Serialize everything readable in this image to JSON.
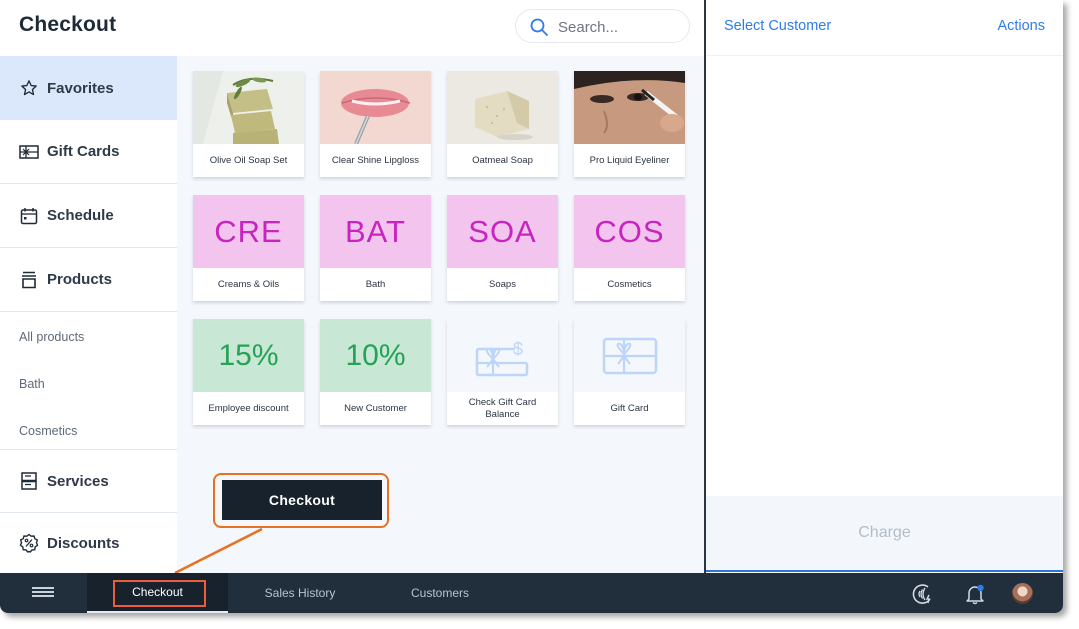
{
  "header": {
    "title": "Checkout",
    "search_placeholder": "Search..."
  },
  "sidebar": {
    "items": [
      {
        "label": "Favorites",
        "icon": "star-icon",
        "active": true
      },
      {
        "label": "Gift Cards",
        "icon": "gift-card-icon"
      },
      {
        "label": "Schedule",
        "icon": "calendar-icon"
      },
      {
        "label": "Products",
        "icon": "box-icon"
      },
      {
        "label": "Services",
        "icon": "services-icon"
      },
      {
        "label": "Discounts",
        "icon": "discount-badge-icon"
      }
    ],
    "product_subitems": [
      "All products",
      "Bath",
      "Cosmetics"
    ]
  },
  "tiles": [
    {
      "label": "Olive Oil Soap Set",
      "kind": "image"
    },
    {
      "label": "Clear Shine Lipgloss",
      "kind": "image"
    },
    {
      "label": "Oatmeal Soap",
      "kind": "image"
    },
    {
      "label": "Pro Liquid Eyeliner",
      "kind": "image"
    },
    {
      "label": "Creams & Oils",
      "kind": "category",
      "abbr": "CRE"
    },
    {
      "label": "Bath",
      "kind": "category",
      "abbr": "BAT"
    },
    {
      "label": "Soaps",
      "kind": "category",
      "abbr": "SOA"
    },
    {
      "label": "Cosmetics",
      "kind": "category",
      "abbr": "COS"
    },
    {
      "label": "Employee discount",
      "kind": "discount",
      "value": "15%"
    },
    {
      "label": "New Customer",
      "kind": "discount",
      "value": "10%"
    },
    {
      "label": "Check Gift Card Balance",
      "kind": "giftcard-balance"
    },
    {
      "label": "Gift Card",
      "kind": "giftcard"
    }
  ],
  "checkout_button": "Checkout",
  "cart": {
    "select_customer": "Select Customer",
    "actions": "Actions",
    "charge": "Charge"
  },
  "bottom_nav": {
    "tabs": [
      {
        "label": "Checkout",
        "active": true
      },
      {
        "label": "Sales History"
      },
      {
        "label": "Customers"
      }
    ],
    "icons": [
      "contactless-payment-icon",
      "notification-bell-icon",
      "user-avatar"
    ]
  },
  "colors": {
    "accent_blue": "#2f7bea",
    "category_bg": "#f2c4ee",
    "category_text": "#c724c0",
    "discount_bg": "#c8e7d5",
    "discount_text": "#26a256",
    "callout_orange": "#e8711f",
    "tab_highlight": "#ee5b3a",
    "dark_bar": "#212e3c"
  }
}
